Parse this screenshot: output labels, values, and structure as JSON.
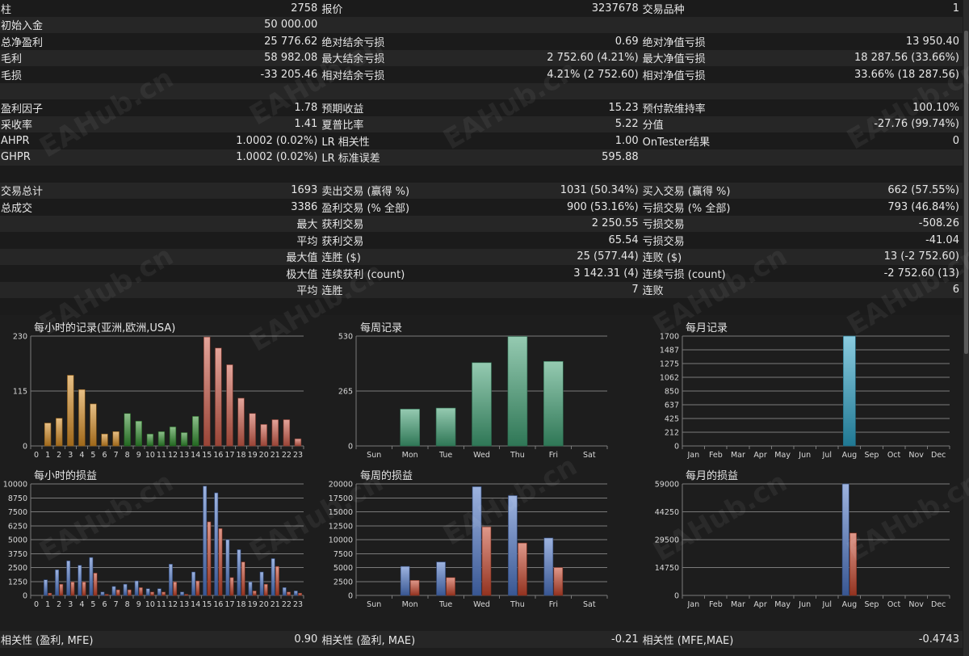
{
  "stats_rows": [
    [
      {
        "label": "柱",
        "value": "2758"
      },
      {
        "label": "报价",
        "value": "3237678"
      },
      {
        "label": "交易品种",
        "value": "1"
      }
    ],
    [
      {
        "label": "初始入金",
        "value": "50 000.00"
      },
      {
        "label": "",
        "value": ""
      },
      {
        "label": "",
        "value": ""
      }
    ],
    [
      {
        "label": "总净盈利",
        "value": "25 776.62"
      },
      {
        "label": "绝对结余亏损",
        "value": "0.69"
      },
      {
        "label": "绝对净值亏损",
        "value": "13 950.40"
      }
    ],
    [
      {
        "label": "毛利",
        "value": "58 982.08"
      },
      {
        "label": "最大结余亏损",
        "value": "2 752.60 (4.21%)"
      },
      {
        "label": "最大净值亏损",
        "value": "18 287.56 (33.66%)"
      }
    ],
    [
      {
        "label": "毛损",
        "value": "-33 205.46"
      },
      {
        "label": "相对结余亏损",
        "value": "4.21% (2 752.60)"
      },
      {
        "label": "相对净值亏损",
        "value": "33.66% (18 287.56)"
      }
    ],
    [
      {
        "label": "",
        "value": ""
      },
      {
        "label": "",
        "value": ""
      },
      {
        "label": "",
        "value": ""
      }
    ],
    [
      {
        "label": "盈利因子",
        "value": "1.78"
      },
      {
        "label": "预期收益",
        "value": "15.23"
      },
      {
        "label": "预付款维持率",
        "value": "100.10%"
      }
    ],
    [
      {
        "label": "采收率",
        "value": "1.41"
      },
      {
        "label": "夏普比率",
        "value": "5.22"
      },
      {
        "label": "分值",
        "value": "-27.76 (99.74%)"
      }
    ],
    [
      {
        "label": "AHPR",
        "value": "1.0002 (0.02%)"
      },
      {
        "label": "LR 相关性",
        "value": "1.00"
      },
      {
        "label": "OnTester结果",
        "value": "0"
      }
    ],
    [
      {
        "label": "GHPR",
        "value": "1.0002 (0.02%)"
      },
      {
        "label": "LR 标准误差",
        "value": "595.88"
      },
      {
        "label": "",
        "value": ""
      }
    ],
    [
      {
        "label": "",
        "value": ""
      },
      {
        "label": "",
        "value": ""
      },
      {
        "label": "",
        "value": ""
      }
    ],
    [
      {
        "label": "交易总计",
        "value": "1693"
      },
      {
        "label": "卖出交易 (赢得 %)",
        "value": "1031 (50.34%)"
      },
      {
        "label": "买入交易 (赢得 %)",
        "value": "662 (57.55%)"
      }
    ],
    [
      {
        "label": "总成交",
        "value": "3386"
      },
      {
        "label": "盈利交易 (% 全部)",
        "value": "900 (53.16%)"
      },
      {
        "label": "亏损交易 (% 全部)",
        "value": "793 (46.84%)"
      }
    ],
    [
      {
        "label": "最大",
        "value": "",
        "right": true
      },
      {
        "label": "获利交易",
        "value": "2 250.55"
      },
      {
        "label": "亏损交易",
        "value": "-508.26"
      }
    ],
    [
      {
        "label": "平均",
        "value": "",
        "right": true
      },
      {
        "label": "获利交易",
        "value": "65.54"
      },
      {
        "label": "亏损交易",
        "value": "-41.04"
      }
    ],
    [
      {
        "label": "最大值",
        "value": "",
        "right": true
      },
      {
        "label": "连胜 ($)",
        "value": "25 (577.44)"
      },
      {
        "label": "连败 ($)",
        "value": "13 (-2 752.60)"
      }
    ],
    [
      {
        "label": "极大值",
        "value": "",
        "right": true
      },
      {
        "label": "连续获利 (count)",
        "value": "3 142.31 (4)"
      },
      {
        "label": "连续亏损 (count)",
        "value": "-2 752.60 (13)"
      }
    ],
    [
      {
        "label": "平均",
        "value": "",
        "right": true
      },
      {
        "label": "连胜",
        "value": "7"
      },
      {
        "label": "连败",
        "value": "6"
      }
    ],
    [
      {
        "label": "",
        "value": ""
      },
      {
        "label": "",
        "value": ""
      },
      {
        "label": "",
        "value": ""
      }
    ]
  ],
  "correlation": [
    {
      "label": "相关性 (盈利, MFE)",
      "value": "0.90"
    },
    {
      "label": "相关性 (盈利, MAE)",
      "value": "-0.21"
    },
    {
      "label": "相关性 (MFE,MAE)",
      "value": "-0.4743"
    }
  ],
  "watermark": "EAHub.cn",
  "colors": {
    "orange": "#d48a22",
    "green": "#2f8a2c",
    "red": "#cc5a48",
    "teal": "#3f9e72",
    "cyan": "#2aa0c4",
    "blue": "#4c74c4",
    "loss_red": "#c4442a",
    "grid": "#7a7a7a"
  },
  "chart_data": [
    {
      "type": "bar",
      "title": "每小时的记录(亚洲,欧洲,USA)",
      "categories": [
        "0",
        "1",
        "2",
        "3",
        "4",
        "5",
        "6",
        "7",
        "8",
        "9",
        "10",
        "11",
        "12",
        "13",
        "14",
        "15",
        "16",
        "17",
        "18",
        "19",
        "20",
        "21",
        "22",
        "23"
      ],
      "values": [
        0,
        48,
        58,
        148,
        118,
        88,
        25,
        30,
        68,
        52,
        25,
        30,
        40,
        28,
        62,
        228,
        205,
        170,
        100,
        68,
        45,
        55,
        55,
        15
      ],
      "segments": [
        "orange",
        "orange",
        "orange",
        "orange",
        "orange",
        "orange",
        "orange",
        "orange",
        "green",
        "green",
        "green",
        "green",
        "green",
        "green",
        "green",
        "red",
        "red",
        "red",
        "red",
        "red",
        "red",
        "red",
        "red",
        "red"
      ],
      "yticks": [
        "0",
        "115",
        "230"
      ],
      "ylim": [
        0,
        230
      ]
    },
    {
      "type": "bar",
      "title": "每周记录",
      "categories": [
        "Sun",
        "Mon",
        "Tue",
        "Wed",
        "Thu",
        "Fri",
        "Sat"
      ],
      "values": [
        0,
        178,
        183,
        402,
        528,
        408,
        0
      ],
      "yticks": [
        "0",
        "265",
        "530"
      ],
      "ylim": [
        0,
        530
      ]
    },
    {
      "type": "bar",
      "title": "每月记录",
      "categories": [
        "Jan",
        "Feb",
        "Mar",
        "Apr",
        "May",
        "Jun",
        "Jul",
        "Aug",
        "Sep",
        "Oct",
        "Nov",
        "Dec"
      ],
      "values": [
        0,
        0,
        0,
        0,
        0,
        0,
        0,
        1700,
        0,
        0,
        0,
        0
      ],
      "yticks": [
        "0",
        "212",
        "425",
        "637",
        "850",
        "1062",
        "1275",
        "1487",
        "1700"
      ],
      "ylim": [
        0,
        1700
      ]
    },
    {
      "type": "bar",
      "title": "每小时的损益",
      "categories": [
        "0",
        "1",
        "2",
        "3",
        "4",
        "5",
        "6",
        "7",
        "8",
        "9",
        "10",
        "11",
        "12",
        "13",
        "14",
        "15",
        "16",
        "17",
        "18",
        "19",
        "20",
        "21",
        "22",
        "23"
      ],
      "series": [
        {
          "values": [
            0,
            1400,
            2300,
            3100,
            2700,
            3400,
            300,
            800,
            1000,
            1300,
            600,
            600,
            2800,
            300,
            2100,
            9800,
            9200,
            5000,
            4100,
            1200,
            2100,
            3300,
            700,
            400
          ]
        },
        {
          "values": [
            0,
            200,
            1000,
            1200,
            1200,
            2000,
            100,
            500,
            500,
            700,
            300,
            300,
            1200,
            100,
            1300,
            6600,
            6000,
            1600,
            3000,
            400,
            1000,
            2600,
            300,
            200
          ]
        }
      ],
      "yticks": [
        "0",
        "1250",
        "2500",
        "3750",
        "5000",
        "6250",
        "7500",
        "8750",
        "10000"
      ],
      "ylim": [
        0,
        10000
      ]
    },
    {
      "type": "bar",
      "title": "每周的损益",
      "categories": [
        "Sun",
        "Mon",
        "Tue",
        "Wed",
        "Thu",
        "Fri",
        "Sat"
      ],
      "series": [
        {
          "values": [
            0,
            5200,
            6000,
            19500,
            17900,
            10300,
            0
          ]
        },
        {
          "values": [
            0,
            2700,
            3200,
            12300,
            9400,
            5000,
            0
          ]
        }
      ],
      "yticks": [
        "0",
        "2500",
        "5000",
        "7500",
        "10000",
        "12500",
        "15000",
        "17500",
        "20000"
      ],
      "ylim": [
        0,
        20000
      ]
    },
    {
      "type": "bar",
      "title": "每月的损益",
      "categories": [
        "Jan",
        "Feb",
        "Mar",
        "Apr",
        "May",
        "Jun",
        "Jul",
        "Aug",
        "Sep",
        "Oct",
        "Nov",
        "Dec"
      ],
      "series": [
        {
          "values": [
            0,
            0,
            0,
            0,
            0,
            0,
            0,
            59000,
            0,
            0,
            0,
            0
          ]
        },
        {
          "values": [
            0,
            0,
            0,
            0,
            0,
            0,
            0,
            33000,
            0,
            0,
            0,
            0
          ]
        }
      ],
      "yticks": [
        "0",
        "14750",
        "29500",
        "44250",
        "59000"
      ],
      "ylim": [
        0,
        59000
      ]
    }
  ]
}
